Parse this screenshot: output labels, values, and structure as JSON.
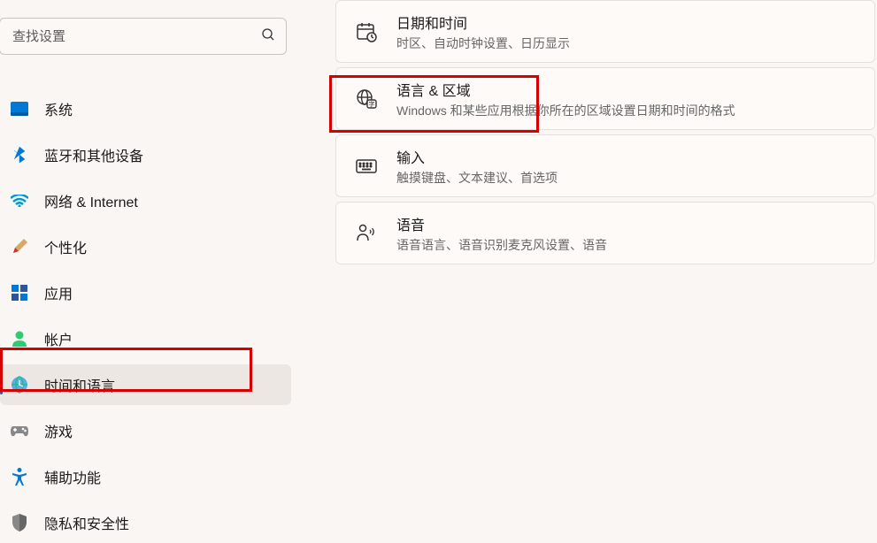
{
  "search": {
    "placeholder": "查找设置"
  },
  "nav": {
    "items": [
      {
        "label": "系统",
        "icon": "system"
      },
      {
        "label": "蓝牙和其他设备",
        "icon": "bluetooth"
      },
      {
        "label": "网络 & Internet",
        "icon": "network"
      },
      {
        "label": "个性化",
        "icon": "personalization"
      },
      {
        "label": "应用",
        "icon": "apps"
      },
      {
        "label": "帐户",
        "icon": "accounts"
      },
      {
        "label": "时间和语言",
        "icon": "time-language"
      },
      {
        "label": "游戏",
        "icon": "gaming"
      },
      {
        "label": "辅助功能",
        "icon": "accessibility"
      },
      {
        "label": "隐私和安全性",
        "icon": "privacy"
      }
    ],
    "selected": 6
  },
  "tiles": [
    {
      "title": "日期和时间",
      "desc": "时区、自动时钟设置、日历显示",
      "icon": "datetime"
    },
    {
      "title": "语言 & 区域",
      "desc": "Windows 和某些应用根据你所在的区域设置日期和时间的格式",
      "icon": "language"
    },
    {
      "title": "输入",
      "desc": "触摸键盘、文本建议、首选项",
      "icon": "keyboard"
    },
    {
      "title": "语音",
      "desc": "语音语言、语音识别麦克风设置、语音",
      "icon": "speech"
    }
  ]
}
